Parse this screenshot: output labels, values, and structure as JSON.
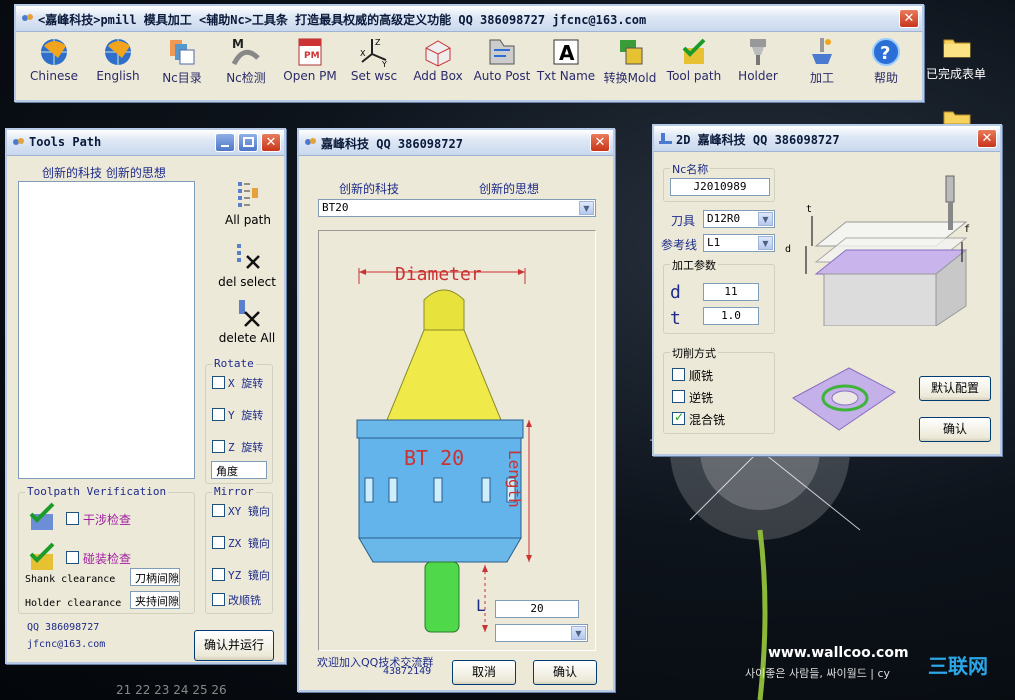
{
  "desktop": {
    "icon_label": "已完成表单",
    "wallpaper_url": "www.wallcoo.com",
    "wallpaper_caption": "사이좋은 사람들, 싸이월드 | cy",
    "watermark": "三联网",
    "calendar_nums": "21 22 23 24 25 26"
  },
  "toolbar": {
    "title": "<嘉峰科技>pmill 模具加工 <辅助Nc>工具条  打造最具权威的高级定义功能  QQ 386098727 jfcnc@163.com",
    "close": "✕",
    "items": [
      {
        "label": "Chinese"
      },
      {
        "label": "English"
      },
      {
        "label": "Nc目录"
      },
      {
        "label": "Nc检测"
      },
      {
        "label": "Open PM"
      },
      {
        "label": "Set wsc"
      },
      {
        "label": "Add Box"
      },
      {
        "label": "Auto Post"
      },
      {
        "label": "Txt Name"
      },
      {
        "label": "转换Mold"
      },
      {
        "label": "Tool path"
      },
      {
        "label": "Holder"
      },
      {
        "label": "加工"
      },
      {
        "label": "帮助"
      }
    ]
  },
  "tools_path": {
    "title": "Tools Path",
    "slogan": "创新的科技 创新的思想",
    "all_path": "All path",
    "del_select": "del select",
    "delete_all": "delete All",
    "rotate": {
      "title": "Rotate",
      "x": "X 旋转",
      "y": "Y 旋转",
      "z": "Z 旋转",
      "angle": "角度"
    },
    "verify": {
      "title": "Toolpath Verification",
      "interference": "干涉检查",
      "collision": "碰装检查",
      "shank_label": "Shank clearance",
      "shank_value": "刀柄间隙",
      "holder_label": "Holder clearance",
      "holder_value": "夹持间隙"
    },
    "mirror": {
      "title": "Mirror",
      "xy": "XY 镜向",
      "zx": "ZX 镜向",
      "yz": "YZ 镜向",
      "reverse": "改顺铣"
    },
    "qq": "QQ 386098727",
    "email": "jfcnc@163.com",
    "run": "确认并运行"
  },
  "holder": {
    "title": "嘉峰科技 QQ 386098727",
    "left_slogan": "创新的科技",
    "right_slogan": "创新的思想",
    "select": "BT20",
    "diameter": "Diameter",
    "bt": "BT 20",
    "length": "Length",
    "l": "L",
    "l_value": "20",
    "welcome": "欢迎加入QQ技术交流群",
    "group_num": "43872149",
    "cancel": "取消",
    "ok": "确认"
  },
  "twod": {
    "title": "2D  嘉峰科技 QQ 386098727",
    "nc_group": "Nc名称",
    "nc_value": "J2010989",
    "tool_label": "刀具",
    "tool_value": "D12R0",
    "ref_label": "参考线",
    "ref_value": "L1",
    "params": "加工参数",
    "d": "d",
    "d_value": "11",
    "t": "t",
    "t_value": "1.0",
    "fig_t": "t",
    "fig_d": "d",
    "fig_f": "f",
    "cut": "切削方式",
    "climb": "顺铣",
    "conv": "逆铣",
    "mixed": "混合铣",
    "default": "默认配置",
    "ok": "确认"
  }
}
